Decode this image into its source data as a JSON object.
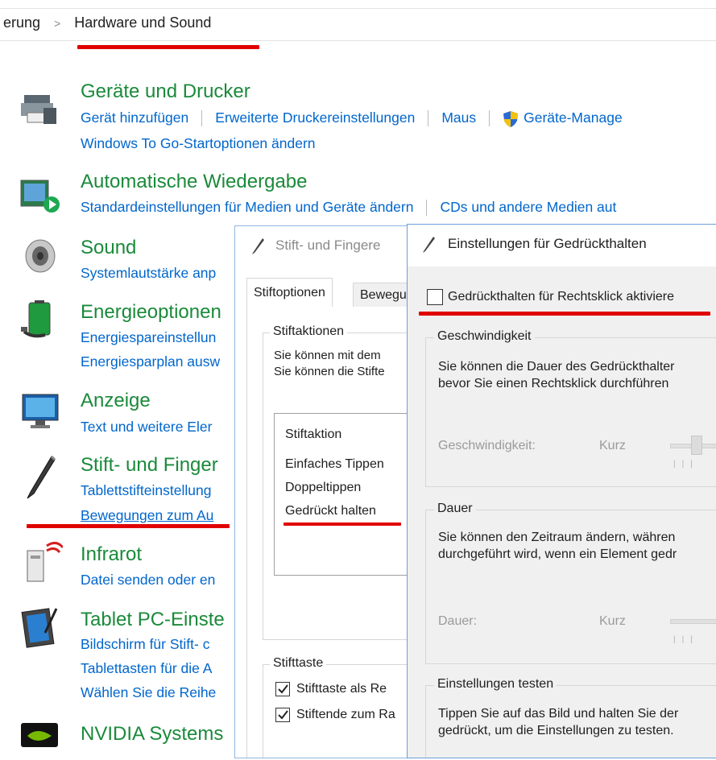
{
  "breadcrumb": {
    "prev": "erung",
    "current": "Hardware und Sound"
  },
  "categories": [
    {
      "title": "Geräte und Drucker",
      "icon": "printer-icon",
      "links_row1": [
        "Gerät hinzufügen",
        "Erweiterte Druckereinstellungen",
        "Maus",
        "Geräte-Manage"
      ],
      "links_row2": [
        "Windows To Go-Startoptionen ändern"
      ]
    },
    {
      "title": "Automatische Wiedergabe",
      "icon": "autoplay-icon",
      "links_row1": [
        "Standardeinstellungen für Medien und Geräte ändern",
        "CDs und andere Medien aut"
      ]
    },
    {
      "title": "Sound",
      "icon": "speaker-icon",
      "links": [
        "Systemlautstärke anp"
      ]
    },
    {
      "title": "Energieoptionen",
      "icon": "battery-icon",
      "links": [
        "Energiespareinstellun",
        "Energiesparplan ausw"
      ]
    },
    {
      "title": "Anzeige",
      "icon": "monitor-icon",
      "links": [
        "Text und weitere Eler"
      ]
    },
    {
      "title": "Stift- und Finger",
      "icon": "pen-icon",
      "links": [
        "Tablettstifteinstellung",
        "Bewegungen zum Au"
      ]
    },
    {
      "title": "Infrarot",
      "icon": "infrared-icon",
      "links": [
        "Datei senden oder en"
      ]
    },
    {
      "title": "Tablet PC-Einste",
      "icon": "tablet-icon",
      "links": [
        "Bildschirm für Stift- c",
        "Tablettasten für die A",
        "Wählen Sie die Reihe"
      ]
    },
    {
      "title": "NVIDIA Systems",
      "icon": "nvidia-icon",
      "links": []
    }
  ],
  "dialog1": {
    "title": "Stift- und Fingere",
    "tabs": [
      "Stiftoptionen",
      "Bewegu"
    ],
    "group_pen_actions": {
      "legend": "Stiftaktionen",
      "lines": [
        "Sie können mit dem",
        "Sie können die Stifte"
      ]
    },
    "list_header": "Stiftaktion",
    "list_items": [
      "Einfaches Tippen",
      "Doppeltippen",
      "Gedrückt halten"
    ],
    "group_pen_button": {
      "legend": "Stifttaste",
      "options": [
        "Stifttaste als Re",
        "Stiftende zum Ra"
      ]
    }
  },
  "dialog2": {
    "title": "Einstellungen für Gedrückthalten",
    "enable_checkbox": "Gedrückthalten für Rechtsklick aktiviere",
    "group_speed": {
      "legend": "Geschwindigkeit",
      "lines": [
        "Sie können die Dauer des Gedrückthalter",
        "bevor Sie einen Rechtsklick durchführen"
      ],
      "slider_label": "Geschwindigkeit:",
      "slider_min": "Kurz"
    },
    "group_duration": {
      "legend": "Dauer",
      "lines": [
        "Sie können den Zeitraum ändern, währen",
        "durchgeführt wird, wenn ein Element gedr"
      ],
      "slider_label": "Dauer:",
      "slider_min": "Kurz"
    },
    "group_test": {
      "legend": "Einstellungen testen",
      "lines": [
        "Tippen Sie auf das Bild und halten Sie der",
        "gedrückt, um die Einstellungen zu testen."
      ]
    }
  },
  "colors": {
    "link": "#0066cc",
    "heading": "#1a8a3a",
    "highlight": "#e00000"
  }
}
